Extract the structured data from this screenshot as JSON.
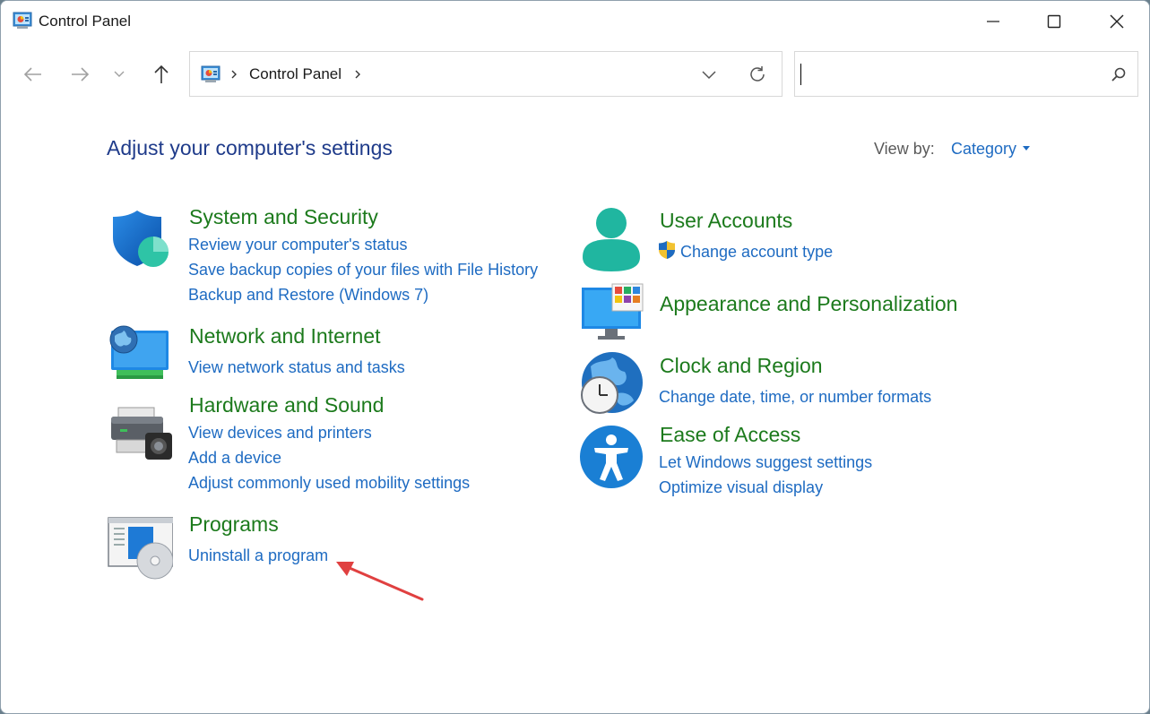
{
  "window": {
    "title": "Control Panel"
  },
  "address_bar": {
    "path_item": "Control Panel"
  },
  "search": {
    "value": "",
    "placeholder": ""
  },
  "header": {
    "heading": "Adjust your computer's settings",
    "view_by_label": "View by:",
    "view_by_value": "Category"
  },
  "categories": {
    "system_security": {
      "title": "System and Security",
      "links": [
        "Review your computer's status",
        "Save backup copies of your files with File History",
        "Backup and Restore (Windows 7)"
      ]
    },
    "network": {
      "title": "Network and Internet",
      "links": [
        "View network status and tasks"
      ]
    },
    "hardware": {
      "title": "Hardware and Sound",
      "links": [
        "View devices and printers",
        "Add a device",
        "Adjust commonly used mobility settings"
      ]
    },
    "programs": {
      "title": "Programs",
      "links": [
        "Uninstall a program"
      ]
    },
    "user_accounts": {
      "title": "User Accounts",
      "links": [
        "Change account type"
      ]
    },
    "appearance": {
      "title": "Appearance and Personalization",
      "links": []
    },
    "clock_region": {
      "title": "Clock and Region",
      "links": [
        "Change date, time, or number formats"
      ]
    },
    "ease_access": {
      "title": "Ease of Access",
      "links": [
        "Let Windows suggest settings",
        "Optimize visual display"
      ]
    }
  },
  "colors": {
    "heading": "#1f3b8a",
    "category_title": "#1c7a1c",
    "link": "#1e6bc2",
    "annotation_arrow": "#e04040"
  }
}
